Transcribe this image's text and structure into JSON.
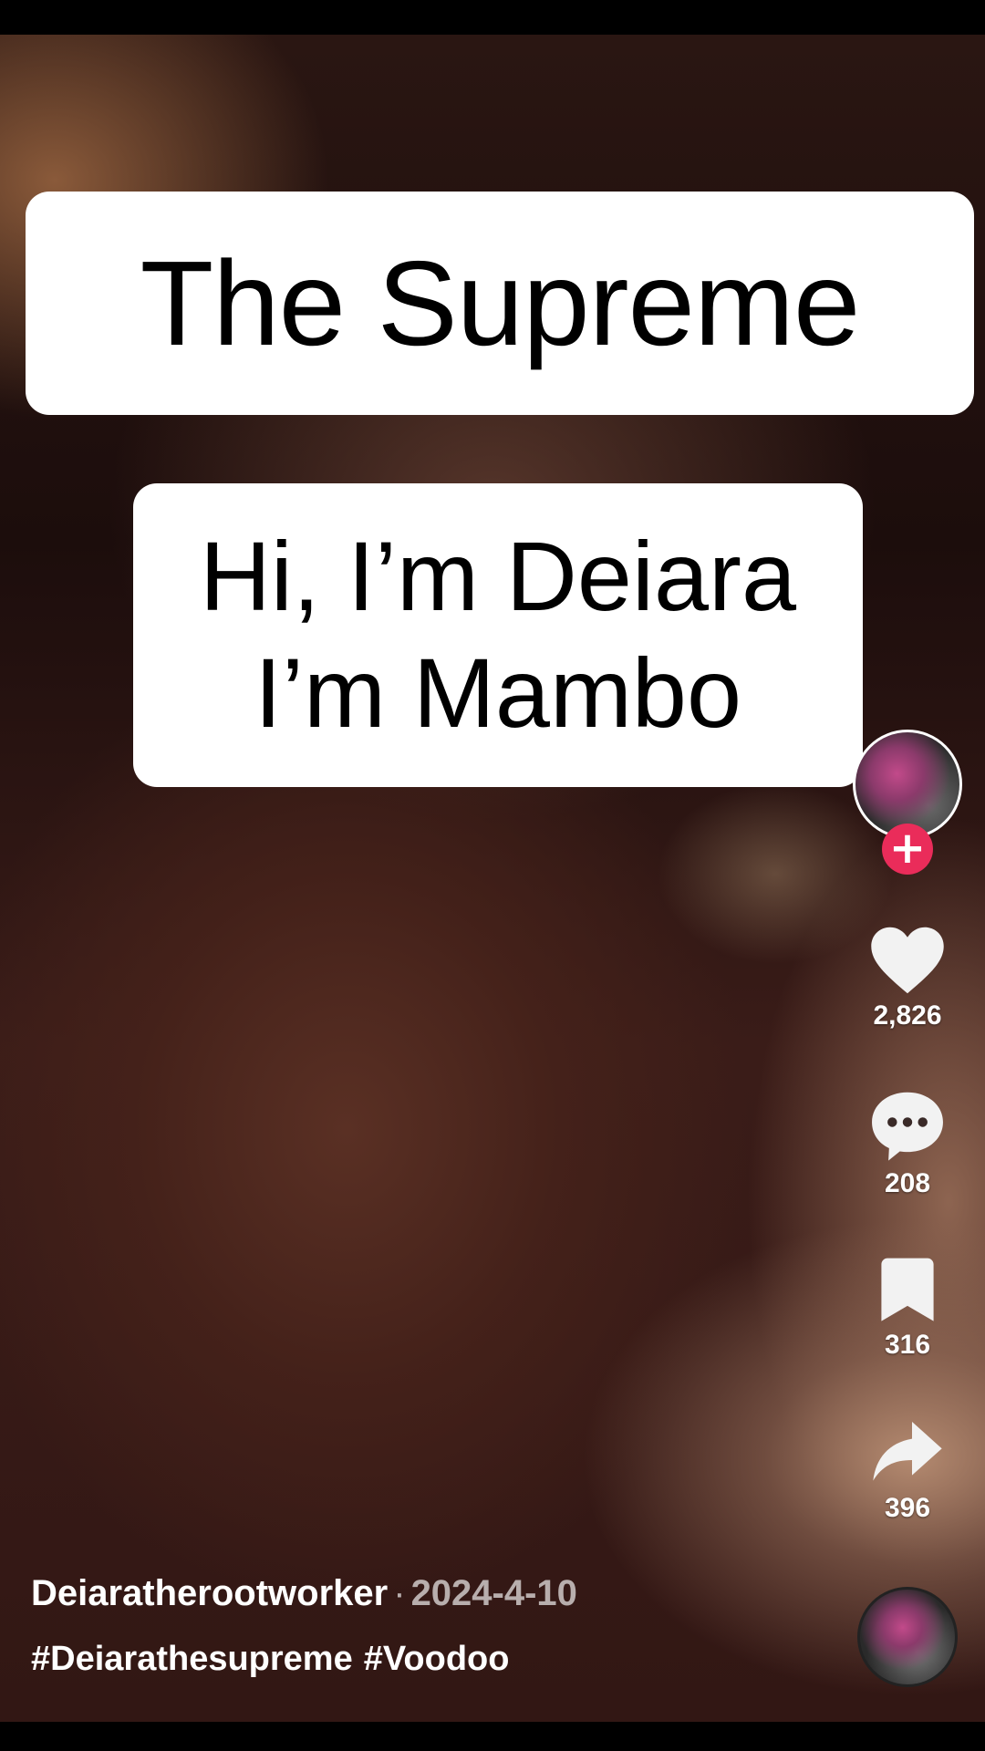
{
  "overlay_captions": {
    "caption_1": "The Supreme",
    "caption_2_line_1": "Hi, I’m Deiara",
    "caption_2_line_2": "I’m Mambo"
  },
  "side_rail": {
    "profile_icon": "avatar",
    "follow_icon": "plus-icon",
    "follow_symbol": "+",
    "like": {
      "icon": "heart-icon",
      "count": "2,826"
    },
    "comment": {
      "icon": "comment-icon",
      "count": "208"
    },
    "save": {
      "icon": "bookmark-icon",
      "count": "316"
    },
    "share": {
      "icon": "share-icon",
      "count": "396"
    },
    "music_icon": "music-disc"
  },
  "post": {
    "username": "Deiaratherootworker",
    "separator": "·",
    "date": "2024-4-10",
    "hashtags": [
      "#Deiarathesupreme",
      "#Voodoo"
    ]
  },
  "colors": {
    "follow_button": "#ea2c5a",
    "caption_background": "#ffffff",
    "caption_text": "#000000"
  }
}
